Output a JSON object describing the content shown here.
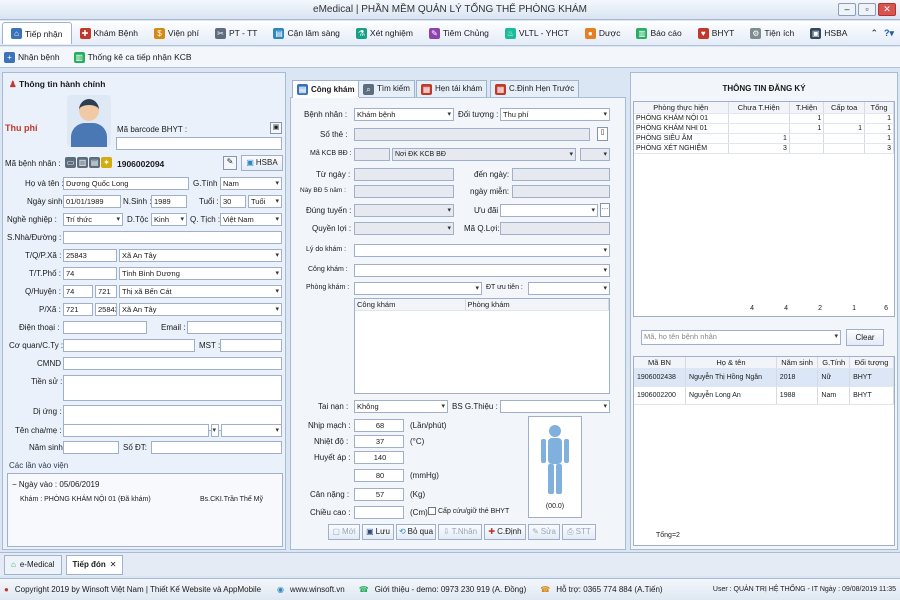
{
  "app": {
    "title": "eMedical | PHẦN MỀM QUẢN LÝ TỔNG THỂ PHÒNG KHÁM"
  },
  "menu": {
    "items": [
      "Tiếp nhận",
      "Khám Bệnh",
      "Viện phí",
      "PT - TT",
      "Cận lâm sàng",
      "Xét nghiệm",
      "Tiêm Chủng",
      "VLTL - YHCT",
      "Dược",
      "Báo cáo",
      "BHYT",
      "Tiện ích",
      "HSBA"
    ]
  },
  "submenu": {
    "items": [
      "Nhận bệnh",
      "Thống kê ca tiếp nhận KCB"
    ]
  },
  "left": {
    "section_title": "Thông tin hành chính",
    "thu_phi": "Thu phí",
    "barcode_label": "Mã barcode BHYT :",
    "ma_bn_label": "Mã bệnh nhân :",
    "ma_bn": "1906002094",
    "btn_hsba": "HSBA",
    "hoten_label": "Họ và tên :",
    "hoten": "Dương Quốc Long",
    "gtinh_label": "G.Tính :",
    "gtinh": "Nam",
    "ngaysinh_label": "Ngày sinh :",
    "ngaysinh": "01/01/1989",
    "nsinh_label": "N.Sinh :",
    "nsinh": "1989",
    "tuoi_label": "Tuổi :",
    "tuoi": "30",
    "tuoi_unit": "Tuổi",
    "nghe_label": "Nghề nghiệp :",
    "nghe": "Trí thức",
    "dtoc_label": "D.Tộc",
    "dtoc": "Kinh",
    "qtich_label": "Q. Tịch :",
    "qtich": "Việt Nam",
    "sonha_label": "S.Nhà/Đường :",
    "tqpx_label": "T/Q/P.Xã :",
    "tqpx_code": "25843",
    "tqpx": "Xã An Tây",
    "ttpho_label": "T/T.Phố :",
    "ttpho_code": "74",
    "ttpho": "Tỉnh Bình Dương",
    "qhuyen_label": "Q/Huyện :",
    "qhuyen_code1": "74",
    "qhuyen_code2": "721",
    "qhuyen": "Thị xã Bến Cát",
    "pxa_label": "P/Xã :",
    "pxa_code1": "721",
    "pxa_code2": "25843",
    "pxa": "Xã An Tây",
    "dienthoai_label": "Điện thoại :",
    "email_label": "Email :",
    "coquan_label": "Cơ quan/C.Ty :",
    "mst_label": "MST :",
    "cmnd_label": "CMND :",
    "tiensu_label": "Tiền sử :",
    "diung_label": "Dị ứng :",
    "tencha_label": "Tên cha/mẹ :",
    "namsinh_label": "Năm sinh :",
    "sodt_label": "Số ĐT:",
    "history_title": "Các lần vào viện",
    "history_date": "Ngày vào : 05/06/2019",
    "history_kham": "Khám : PHÒNG KHÁM NỘI 01 (Đã khám)",
    "history_bs": "Bs.CKI.Trần Thế Mỹ"
  },
  "center": {
    "tabs": [
      "Công khám",
      "Tìm kiếm",
      "Hẹn tái khám",
      "C.Định Hẹn Trước"
    ],
    "benhnhan_label": "Bệnh nhân :",
    "benhnhan": "Khám bệnh",
    "doituong_label": "Đối tượng :",
    "doituong": "Thu phí",
    "sothe_label": "Số thẻ :",
    "makcbbd_label": "Mã KCB BĐ :",
    "makcbbd": "Nơi ĐK KCB BĐ",
    "tungay_label": "Từ ngày :",
    "denngay_label": "đến ngày:",
    "nay5nam_label": "Này BĐ 5 năm :",
    "ngaymien_label": "ngày miễn:",
    "dungtuyen_label": "Đúng tuyến :",
    "uudai_label": "Ưu đãi :",
    "quyenloi_label": "Quyền lợi :",
    "maqloi_label": "Mã Q.Lợi:",
    "lydo_label": "Lý do khám :",
    "congkham_label": "Công khám :",
    "phongkham_label": "Phòng khám :",
    "dtuutien_label": "ĐT ưu tiên :",
    "grid_headers": [
      "Công khám",
      "Phòng khám"
    ],
    "tainan_label": "Tai nạn :",
    "tainan": "Không",
    "bsgthieu_label": "BS G.Thiệu :",
    "nhipmach_label": "Nhịp mạch :",
    "nhipmach": "68",
    "nhipmach_unit": "(Lần/phút)",
    "nhietdo_label": "Nhiệt độ :",
    "nhietdo": "37",
    "nhietdo_unit": "(°C)",
    "huyetap_label": "Huyết áp :",
    "huyetap1": "140",
    "huyetap2": "80",
    "huyetap_unit": "(mmHg)",
    "cannang_label": "Cân nặng :",
    "cannang": "57",
    "cannang_unit": "(Kg)",
    "chieucao_label": "Chiều cao :",
    "chieucao_unit": "(Cm)",
    "capcuu_label": "Cấp cứu/giữ thẻ BHYT",
    "bmi": "(00.0)",
    "buttons": [
      "Mới",
      "Lưu",
      "Bỏ qua",
      "T.Nhân",
      "C.Định",
      "Sửa",
      "STT"
    ]
  },
  "right": {
    "title": "THÔNG TIN ĐĂNG KÝ",
    "headers": [
      "Phòng thực hiện",
      "Chưa T.Hiện",
      "T.Hiện",
      "Cấp toa",
      "Tổng"
    ],
    "rows": [
      [
        "PHÒNG KHÁM NỘI 01",
        "",
        "1",
        "",
        "1"
      ],
      [
        "PHÒNG KHÁM NHI 01",
        "",
        "1",
        "1",
        "1"
      ],
      [
        "PHÒNG SIÊU ÂM",
        "1",
        "",
        "",
        "1"
      ],
      [
        "PHÒNG XÉT NGHIỆM",
        "3",
        "",
        "",
        "3"
      ]
    ],
    "totals": [
      "4",
      "4",
      "2",
      "1",
      "6"
    ],
    "search_placeholder": "Mã, họ tên bệnh nhân",
    "clear": "Clear",
    "p_headers": [
      "Mã BN",
      "Họ & tên",
      "Năm sinh",
      "G.Tính",
      "Đối tượng"
    ],
    "p_rows": [
      [
        "1906002438",
        "Nguyễn Thị Hồng Ngân",
        "2018",
        "Nữ",
        "BHYT"
      ],
      [
        "1906002200",
        "Nguyễn Long An",
        "1988",
        "Nam",
        "BHYT"
      ]
    ],
    "tong": "Tổng=2"
  },
  "bottomtabs": [
    "e-Medical",
    "Tiếp đón"
  ],
  "status": {
    "copyright": "Copyright 2019 by Winsoft Việt Nam | Thiết Kế Website và AppMobile",
    "web": "www.winsoft.vn",
    "gioithieu": "Giới thiệu - demo: 0973 230 919 (A. Đồng)",
    "hotro": "Hỗ trợ: 0365 774 884 (A.Tiến)",
    "user": "User : QUẢN TRỊ HỆ THỐNG - IT   Ngày : 09/08/2019 11:35"
  }
}
